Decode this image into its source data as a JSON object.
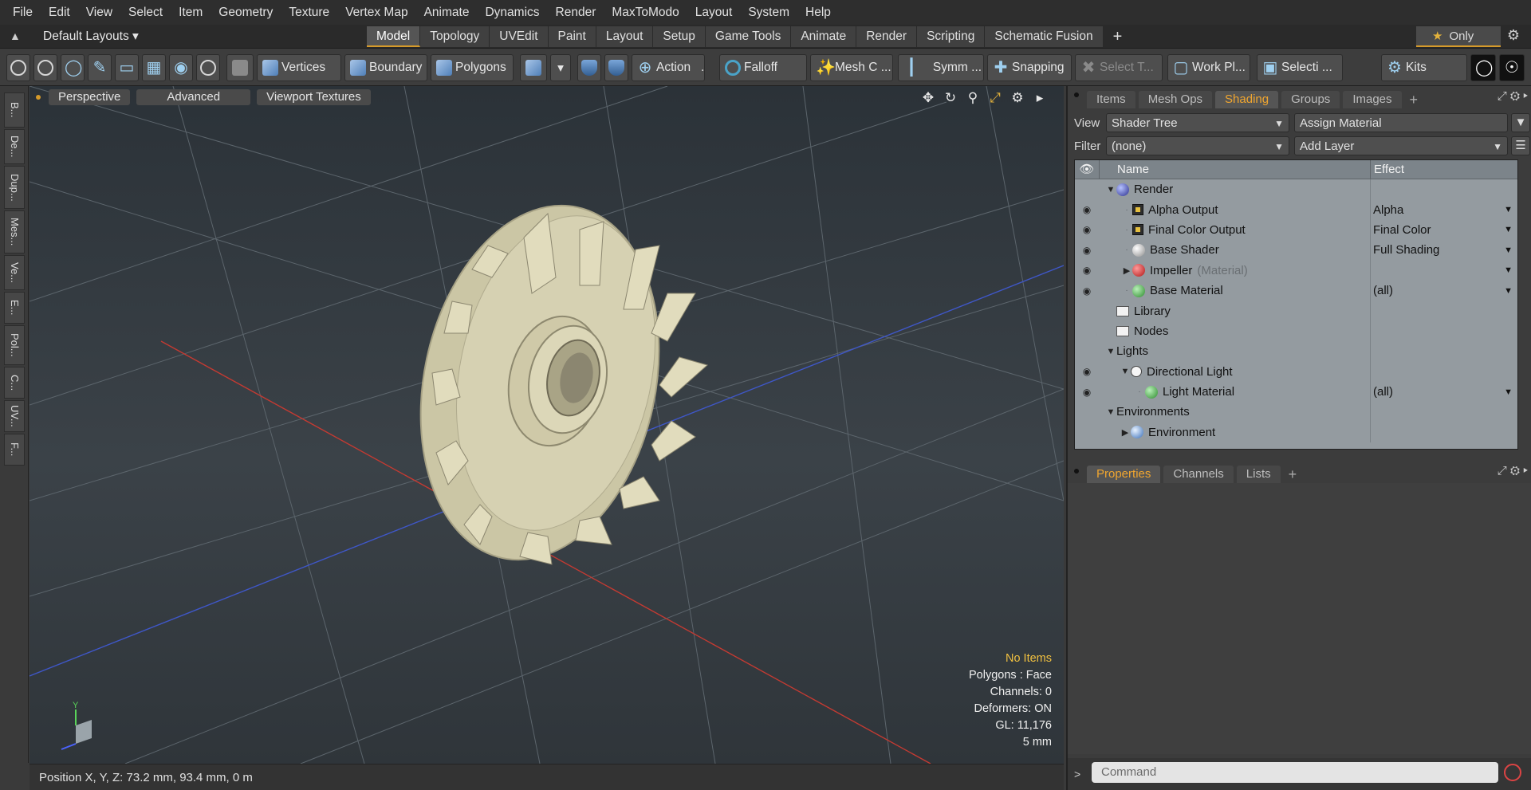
{
  "menu": [
    "File",
    "Edit",
    "View",
    "Select",
    "Item",
    "Geometry",
    "Texture",
    "Vertex Map",
    "Animate",
    "Dynamics",
    "Render",
    "MaxToModo",
    "Layout",
    "System",
    "Help"
  ],
  "layouts_label": "Default Layouts ▾",
  "layout_tabs": [
    {
      "label": "Model",
      "active": true
    },
    {
      "label": "Topology"
    },
    {
      "label": "UVEdit"
    },
    {
      "label": "Paint"
    },
    {
      "label": "Layout"
    },
    {
      "label": "Setup"
    },
    {
      "label": "Game Tools"
    },
    {
      "label": "Animate"
    },
    {
      "label": "Render"
    },
    {
      "label": "Scripting"
    },
    {
      "label": "Schematic Fusion"
    }
  ],
  "layout_plus": "+",
  "only_label": "Only",
  "toolbar": {
    "vertices": "Vertices",
    "boundary": "Boundary",
    "polygons": "Polygons",
    "action": "Action",
    "falloff": "Falloff",
    "meshc": "Mesh C ...",
    "symm": "Symm ...",
    "snapping": "Snapping",
    "selectt": "Select T...",
    "workpl": "Work Pl...",
    "selecti": "Selecti ...",
    "kits": "Kits"
  },
  "left_tabs": [
    "B...",
    "De...",
    "Dup...",
    "Mes...",
    "Ve...",
    "E...",
    "Pol...",
    "C...",
    "UV...",
    "F..."
  ],
  "viewport": {
    "pills": [
      "Perspective",
      "Advanced",
      "Viewport Textures"
    ],
    "info": {
      "no_items": "No Items",
      "polygons": "Polygons : Face",
      "channels": "Channels: 0",
      "deformers": "Deformers: ON",
      "gl": "GL: 11,176",
      "scale": "5 mm"
    }
  },
  "status": "Position X, Y, Z:   73.2 mm, 93.4 mm, 0 m",
  "right": {
    "tabs": [
      "Items",
      "Mesh Ops",
      "Shading",
      "Groups",
      "Images"
    ],
    "active_tab": "Shading",
    "view_label": "View",
    "view_value": "Shader Tree",
    "assign_material": "Assign Material",
    "filter_label": "Filter",
    "filter_value": "(none)",
    "add_layer": "Add Layer",
    "tree_head": {
      "name": "Name",
      "effect": "Effect"
    },
    "tree": [
      {
        "name": "Render",
        "effect": ""
      },
      {
        "name": "Alpha Output",
        "effect": "Alpha"
      },
      {
        "name": "Final Color Output",
        "effect": "Final Color"
      },
      {
        "name": "Base Shader",
        "effect": "Full Shading"
      },
      {
        "name": "Impeller",
        "extra": "(Material)",
        "effect": ""
      },
      {
        "name": "Base Material",
        "effect": "(all)"
      },
      {
        "name": "Library",
        "effect": ""
      },
      {
        "name": "Nodes",
        "effect": ""
      },
      {
        "name": "Lights",
        "effect": ""
      },
      {
        "name": "Directional Light",
        "effect": ""
      },
      {
        "name": "Light Material",
        "effect": "(all)"
      },
      {
        "name": "Environments",
        "effect": ""
      },
      {
        "name": "Environment",
        "effect": ""
      }
    ],
    "props_tabs": [
      "Properties",
      "Channels",
      "Lists"
    ],
    "command_placeholder": "Command"
  }
}
